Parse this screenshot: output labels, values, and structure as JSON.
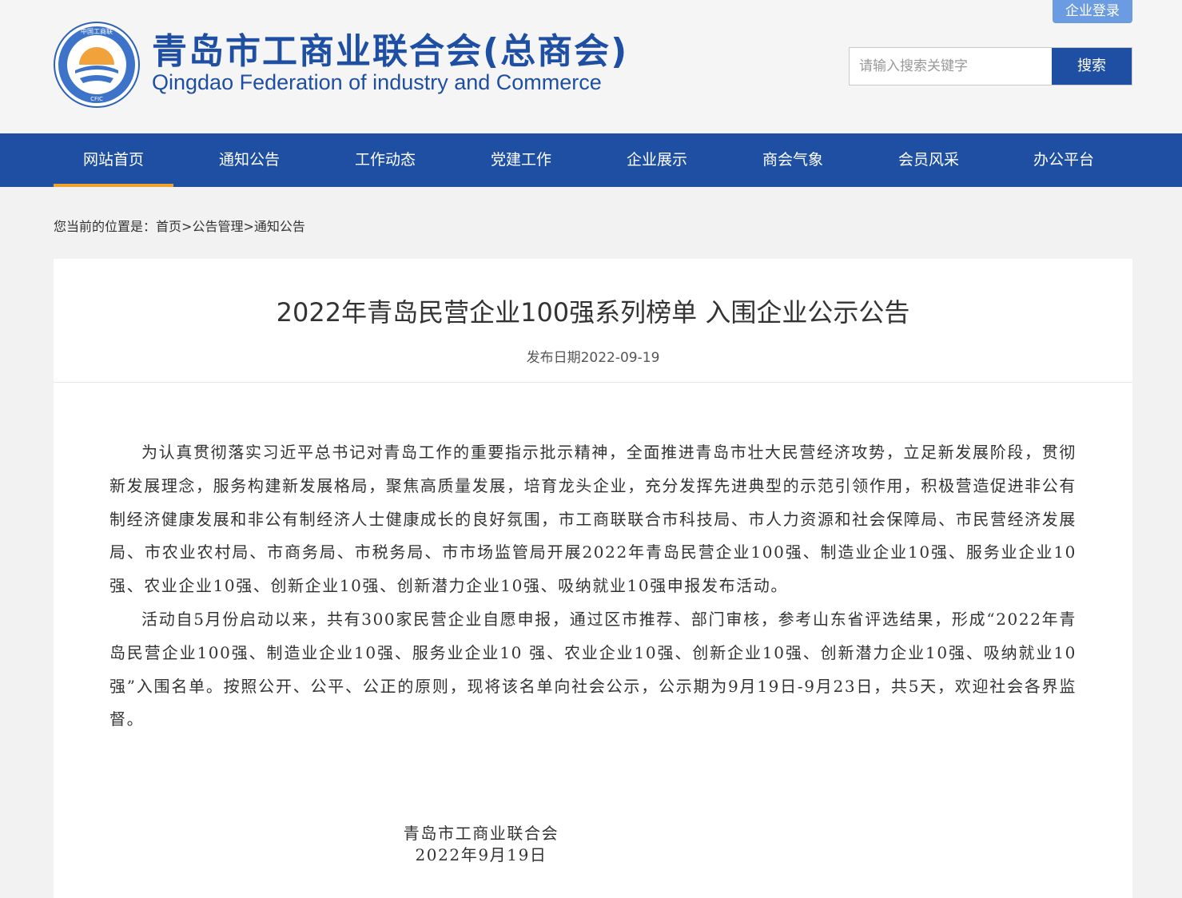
{
  "header": {
    "logo_cn": "青岛市工商业联合会(总商会)",
    "logo_en": "Qingdao Federation of industry and Commerce",
    "emblem_text": "中国工商联",
    "emblem_bottom": "CFIC",
    "login_label": "企业登录",
    "search_placeholder": "请输入搜索关键字",
    "search_label": "搜索"
  },
  "nav": {
    "items": [
      {
        "label": "网站首页"
      },
      {
        "label": "通知公告"
      },
      {
        "label": "工作动态"
      },
      {
        "label": "党建工作"
      },
      {
        "label": "企业展示"
      },
      {
        "label": "商会气象"
      },
      {
        "label": "会员风采"
      },
      {
        "label": "办公平台"
      }
    ]
  },
  "breadcrumb": {
    "prefix": "您当前的位置是：",
    "items": [
      "首页",
      "公告管理",
      "通知公告"
    ],
    "sep": ">"
  },
  "article": {
    "title": "2022年青岛民营企业100强系列榜单 入围企业公示公告",
    "date": "发布日期2022-09-19",
    "para1": "为认真贯彻落实习近平总书记对青岛工作的重要指示批示精神，全面推进青岛市壮大民营经济攻势，立足新发展阶段，贯彻新发展理念，服务构建新发展格局，聚焦高质量发展，培育龙头企业，充分发挥先进典型的示范引领作用，积极营造促进非公有制经济健康发展和非公有制经济人士健康成长的良好氛围，市工商联联合市科技局、市人力资源和社会保障局、市民营经济发展局、市农业农村局、市商务局、市税务局、市市场监管局开展2022年青岛民营企业100强、制造业企业10强、服务业企业10 强、农业企业10强、创新企业10强、创新潜力企业10强、吸纳就业10强申报发布活动。",
    "para2": "活动自5月份启动以来，共有300家民营企业自愿申报，通过区市推荐、部门审核，参考山东省评选结果，形成“2022年青岛民营企业100强、制造业企业10强、服务业企业10 强、农业企业10强、创新企业10强、创新潜力企业10强、吸纳就业10强”入围名单。按照公开、公平、公正的原则，现将该名单向社会公示，公示期为9月19日-9月23日，共5天，欢迎社会各界监督。",
    "sign_org": "青岛市工商业联合会",
    "sign_date": "2022年9月19日"
  },
  "colors": {
    "brand": "#1e4fa3",
    "nav_active_underline": "#f0a12b",
    "login_button": "#6b9be0"
  }
}
